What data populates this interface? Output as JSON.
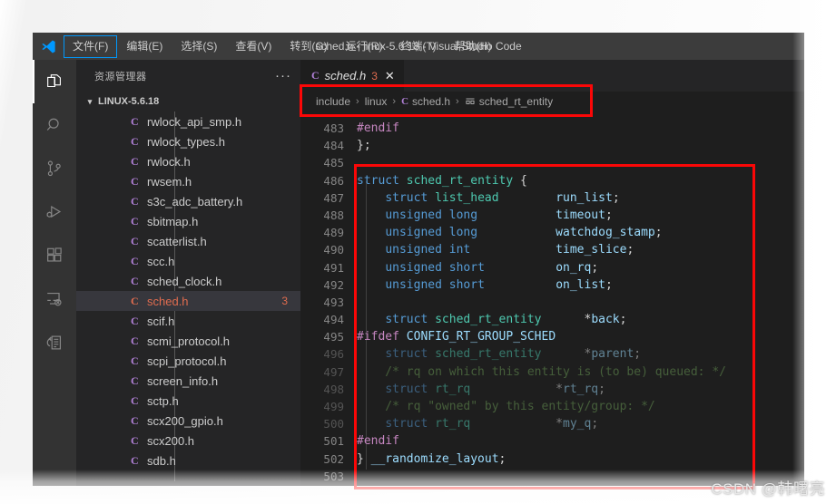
{
  "window": {
    "title": "sched.h - linux-5.6.18 - Visual Studio Code",
    "logo_icon": "vscode-logo-icon"
  },
  "menubar": {
    "items": [
      {
        "label": "文件(F)",
        "active": true
      },
      {
        "label": "编辑(E)",
        "active": false
      },
      {
        "label": "选择(S)",
        "active": false
      },
      {
        "label": "查看(V)",
        "active": false
      },
      {
        "label": "转到(G)",
        "active": false
      },
      {
        "label": "运行(R)",
        "active": false
      },
      {
        "label": "终端(T)",
        "active": false
      },
      {
        "label": "帮助(H)",
        "active": false
      }
    ]
  },
  "activitybar": {
    "items": [
      {
        "name": "explorer-icon",
        "active": true
      },
      {
        "name": "search-icon",
        "active": false
      },
      {
        "name": "source-control-icon",
        "active": false
      },
      {
        "name": "run-and-debug-icon",
        "active": false
      },
      {
        "name": "extensions-icon",
        "active": false
      },
      {
        "name": "remote-explorer-icon",
        "active": false
      },
      {
        "name": "testing-icon",
        "active": false
      }
    ]
  },
  "sidebar": {
    "title": "资源管理器",
    "more_actions": "···",
    "folder": {
      "label": "LINUX-5.6.18",
      "expanded": true,
      "chevron": "⌄"
    },
    "files": [
      {
        "name": "rwlock_api_smp.h",
        "icon": "C",
        "badge": "",
        "selected": false
      },
      {
        "name": "rwlock_types.h",
        "icon": "C",
        "badge": "",
        "selected": false
      },
      {
        "name": "rwlock.h",
        "icon": "C",
        "badge": "",
        "selected": false
      },
      {
        "name": "rwsem.h",
        "icon": "C",
        "badge": "",
        "selected": false
      },
      {
        "name": "s3c_adc_battery.h",
        "icon": "C",
        "badge": "",
        "selected": false
      },
      {
        "name": "sbitmap.h",
        "icon": "C",
        "badge": "",
        "selected": false
      },
      {
        "name": "scatterlist.h",
        "icon": "C",
        "badge": "",
        "selected": false
      },
      {
        "name": "scc.h",
        "icon": "C",
        "badge": "",
        "selected": false
      },
      {
        "name": "sched_clock.h",
        "icon": "C",
        "badge": "",
        "selected": false
      },
      {
        "name": "sched.h",
        "icon": "C",
        "badge": "3",
        "selected": true
      },
      {
        "name": "scif.h",
        "icon": "C",
        "badge": "",
        "selected": false
      },
      {
        "name": "scmi_protocol.h",
        "icon": "C",
        "badge": "",
        "selected": false
      },
      {
        "name": "scpi_protocol.h",
        "icon": "C",
        "badge": "",
        "selected": false
      },
      {
        "name": "screen_info.h",
        "icon": "C",
        "badge": "",
        "selected": false
      },
      {
        "name": "sctp.h",
        "icon": "C",
        "badge": "",
        "selected": false
      },
      {
        "name": "scx200_gpio.h",
        "icon": "C",
        "badge": "",
        "selected": false
      },
      {
        "name": "scx200.h",
        "icon": "C",
        "badge": "",
        "selected": false
      },
      {
        "name": "sdb.h",
        "icon": "C",
        "badge": "",
        "selected": false
      }
    ]
  },
  "editor": {
    "tab": {
      "icon": "C",
      "label": "sched.h",
      "problem_count": "3",
      "close": "✕"
    },
    "breadcrumbs": [
      {
        "label": "include",
        "icon": ""
      },
      {
        "label": "linux",
        "icon": ""
      },
      {
        "label": "sched.h",
        "icon": "c-file-icon"
      },
      {
        "label": "sched_rt_entity",
        "icon": "struct-symbol-icon"
      }
    ],
    "breadcrumb_separator": "›",
    "lines": [
      {
        "num": "483",
        "code": "#endif"
      },
      {
        "num": "484",
        "code": "};"
      },
      {
        "num": "485",
        "code": ""
      },
      {
        "num": "486",
        "code": "struct sched_rt_entity {"
      },
      {
        "num": "487",
        "code": "    struct list_head        run_list;"
      },
      {
        "num": "488",
        "code": "    unsigned long           timeout;"
      },
      {
        "num": "489",
        "code": "    unsigned long           watchdog_stamp;"
      },
      {
        "num": "490",
        "code": "    unsigned int            time_slice;"
      },
      {
        "num": "491",
        "code": "    unsigned short          on_rq;"
      },
      {
        "num": "492",
        "code": "    unsigned short          on_list;"
      },
      {
        "num": "493",
        "code": ""
      },
      {
        "num": "494",
        "code": "    struct sched_rt_entity      *back;"
      },
      {
        "num": "495",
        "code": "#ifdef CONFIG_RT_GROUP_SCHED"
      },
      {
        "num": "496",
        "code": "    struct sched_rt_entity      *parent;"
      },
      {
        "num": "497",
        "code": "    /* rq on which this entity is (to be) queued: */"
      },
      {
        "num": "498",
        "code": "    struct rt_rq            *rt_rq;"
      },
      {
        "num": "499",
        "code": "    /* rq \"owned\" by this entity/group: */"
      },
      {
        "num": "500",
        "code": "    struct rt_rq            *my_q;"
      },
      {
        "num": "501",
        "code": "#endif"
      },
      {
        "num": "502",
        "code": "} __randomize_layout;"
      },
      {
        "num": "503",
        "code": ""
      }
    ]
  },
  "annotations": {
    "breadcrumb_highlight_color": "#fb0707",
    "code_highlight_color": "#fb0707"
  },
  "watermark": {
    "text": "CSDN @韩曙亮"
  }
}
